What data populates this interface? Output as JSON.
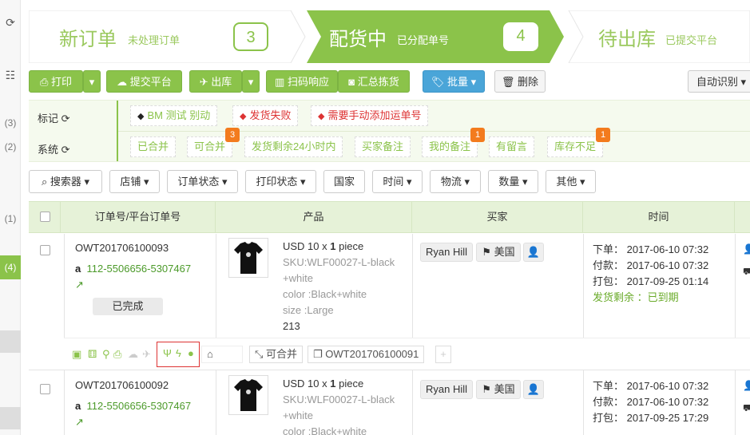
{
  "sidebar": {
    "counts": [
      "(3)",
      "(2)",
      "(1)"
    ],
    "active": "(4)"
  },
  "steps": [
    {
      "title": "新订单",
      "subtitle": "未处理订单",
      "count": "3"
    },
    {
      "title": "配货中",
      "subtitle": "已分配单号",
      "count": "4"
    },
    {
      "title": "待出库",
      "subtitle": "已提交平台"
    }
  ],
  "toolbar": {
    "print": "打印",
    "submit": "提交平台",
    "ship": "出库",
    "scan": "扫码响应",
    "pick": "汇总拣货",
    "batch": "批量",
    "delete": "删除",
    "auto": "自动识别"
  },
  "tags": {
    "label_mark": "标记",
    "label_sys": "系统",
    "marks": [
      "BM 测试 别动",
      "发货失败",
      "需要手动添加运单号"
    ],
    "system": [
      {
        "text": "已合并"
      },
      {
        "text": "可合并",
        "badge": "3"
      },
      {
        "text": "发货剩余24小时内"
      },
      {
        "text": "买家备注"
      },
      {
        "text": "我的备注",
        "badge": "1"
      },
      {
        "text": "有留言"
      },
      {
        "text": "库存不足",
        "badge": "1"
      }
    ]
  },
  "filters": [
    "搜索器",
    "店铺",
    "订单状态",
    "打印状态",
    "国家",
    "时间",
    "物流",
    "数量",
    "其他"
  ],
  "table": {
    "headers": [
      "订单号/平台订单号",
      "产品",
      "买家",
      "时间"
    ]
  },
  "orders": [
    {
      "order_no": "OWT201706100093",
      "platform_no": "112-5506656-5307467",
      "status": "已完成",
      "product": {
        "price": "USD 10 x ",
        "qty": "1",
        "unit": " piece",
        "sku": "SKU:WLF00027-L-black",
        "sku2": "+white",
        "color": "color :Black+white",
        "size": "size :Large",
        "stock": "213"
      },
      "buyer": "Ryan Hill",
      "country": "美国",
      "times": {
        "order": "下单：  2017-06-10 07:32",
        "pay": "付款：  2017-06-10 07:32",
        "pack": "打包：  2017-09-25 01:14"
      },
      "remain": "发货剩余 ：已到期",
      "mergeable": "可合并",
      "related": "OWT201706100091"
    },
    {
      "order_no": "OWT201706100092",
      "platform_no": "112-5506656-5307467",
      "product": {
        "price": "USD 10 x ",
        "qty": "1",
        "unit": " piece",
        "sku": "SKU:WLF00027-L-black",
        "sku2": "+white",
        "color": "color :Black+white"
      },
      "buyer": "Ryan Hill",
      "country": "美国",
      "times": {
        "order": "下单：  2017-06-10 07:32",
        "pay": "付款：  2017-06-10 07:32",
        "pack": "打包：  2017-09-25 17:29"
      }
    }
  ],
  "colors": {
    "accent": "#8bc34a",
    "blue": "#4aa5d8",
    "badge": "#f37b1d"
  }
}
